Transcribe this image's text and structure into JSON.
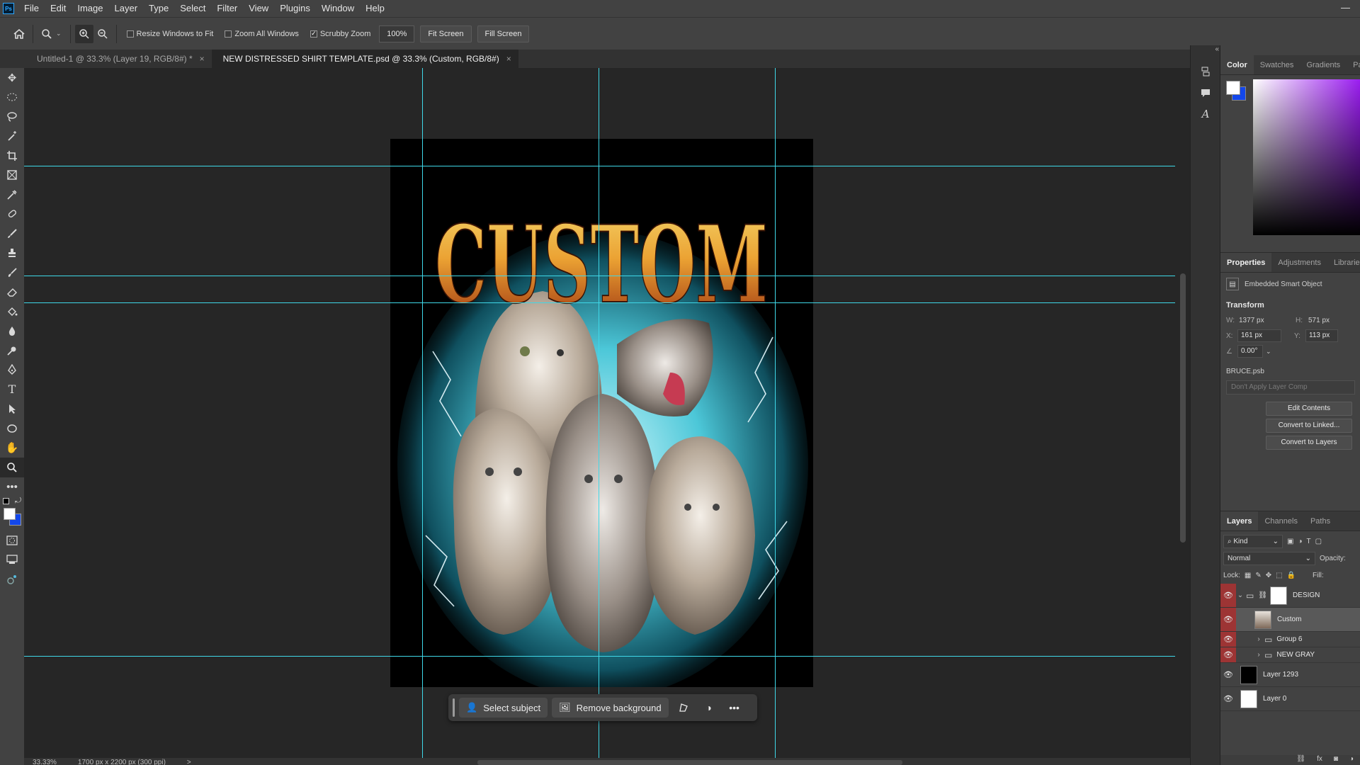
{
  "menubar": {
    "app_icon": "Ps",
    "items": [
      "File",
      "Edit",
      "Image",
      "Layer",
      "Type",
      "Select",
      "Filter",
      "View",
      "Plugins",
      "Window",
      "Help"
    ],
    "minimize": "—"
  },
  "options_bar": {
    "resize_windows_label": "Resize Windows to Fit",
    "resize_windows_checked": false,
    "zoom_all_label": "Zoom All Windows",
    "zoom_all_checked": false,
    "scrubby_zoom_label": "Scrubby Zoom",
    "scrubby_zoom_checked": true,
    "zoom_value": "100%",
    "fit_screen": "Fit Screen",
    "fill_screen": "Fill Screen"
  },
  "tabs": [
    {
      "label": "Untitled-1 @ 33.3% (Layer 19, RGB/8#) *",
      "close": "×",
      "active": false
    },
    {
      "label": "NEW DISTRESSED SHIRT TEMPLATE.psd @ 33.3% (Custom, RGB/8#)",
      "close": "×",
      "active": true
    }
  ],
  "artwork": {
    "headline": "CUSTOM",
    "subject": "cat photo collage",
    "colors": {
      "text_top": "#f2c94c",
      "text_bottom": "#a43a12",
      "glow": "#3ec8d8",
      "background": "#000000"
    }
  },
  "context_bar": {
    "select_subject": "Select subject",
    "remove_background": "Remove background"
  },
  "status": {
    "zoom": "33.33%",
    "doc_size": "1700 px x 2200 px (300 ppi)",
    "arrow": ">"
  },
  "color_panel": {
    "tabs": [
      "Color",
      "Swatches",
      "Gradients",
      "Pa"
    ],
    "foreground": "#ffffff",
    "background": "#1347ea"
  },
  "properties_panel": {
    "tabs": [
      "Properties",
      "Adjustments",
      "Librarie"
    ],
    "object_type": "Embedded Smart Object",
    "transform_title": "Transform",
    "w_label": "W:",
    "w_value": "1377 px",
    "h_label": "H:",
    "h_value": "571 px",
    "x_label": "X:",
    "x_value": "161 px",
    "y_label": "Y:",
    "y_value": "113 px",
    "angle_value": "0.00°",
    "file_name": "BRUCE.psb",
    "layer_comp_placeholder": "Don't Apply Layer Comp",
    "edit_contents": "Edit Contents",
    "convert_linked": "Convert to Linked...",
    "convert_layers": "Convert to Layers"
  },
  "layers_panel": {
    "tabs": [
      "Layers",
      "Channels",
      "Paths"
    ],
    "filter_kind": "Kind",
    "blend_mode": "Normal",
    "opacity_label": "Opacity:",
    "lock_label": "Lock:",
    "fill_label": "Fill:",
    "layers": [
      {
        "name": "DESIGN",
        "type": "group-mask",
        "red": true
      },
      {
        "name": "Custom",
        "type": "smart",
        "red": true,
        "selected": true
      },
      {
        "name": "Group 6",
        "type": "group",
        "red": true
      },
      {
        "name": "NEW GRAY",
        "type": "group",
        "red": true
      },
      {
        "name": "Layer 1293",
        "type": "black",
        "red": false
      },
      {
        "name": "Layer 0",
        "type": "white",
        "red": false
      }
    ],
    "footer_icons": [
      "link-icon",
      "fx-icon",
      "mask-icon",
      "adjustment-icon"
    ],
    "fx_label": "fx"
  }
}
